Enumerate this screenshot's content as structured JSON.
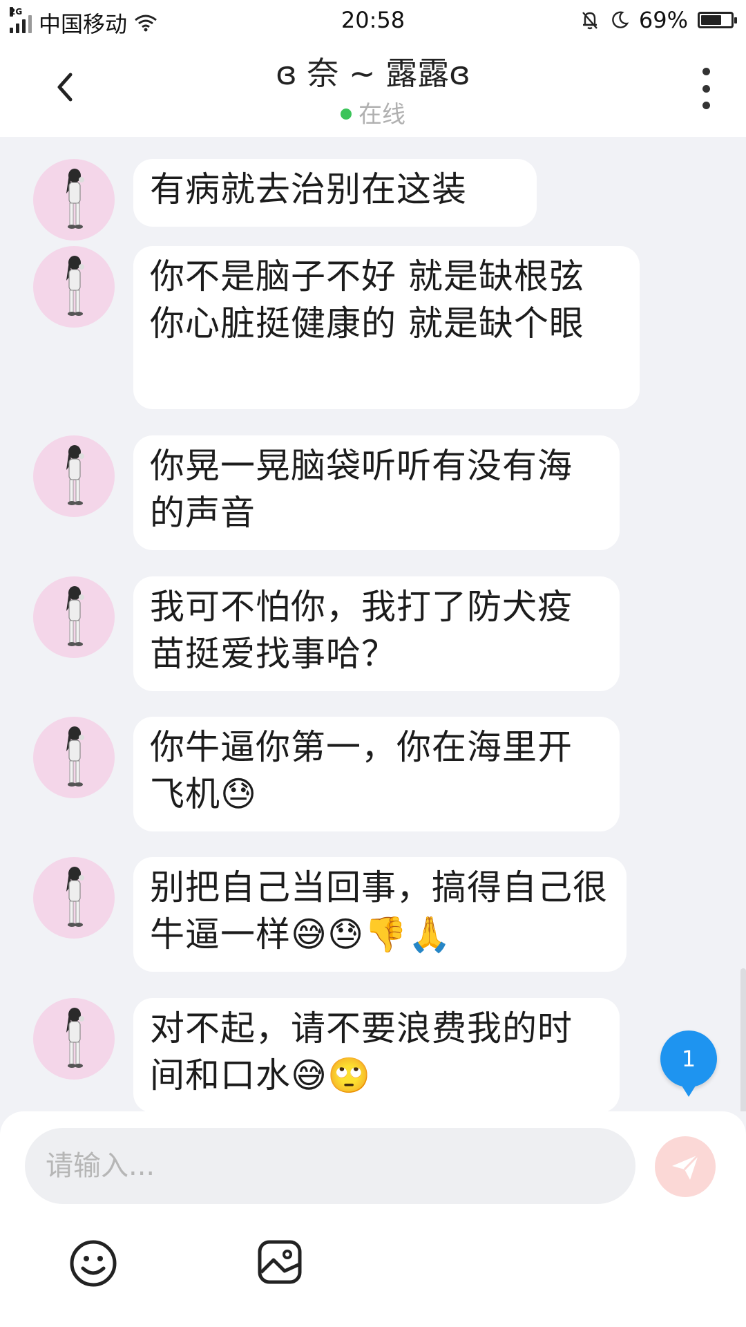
{
  "status_bar": {
    "network_type": "2G",
    "carrier": "中国移动",
    "time": "20:58",
    "battery_percent": "69%",
    "battery_level": 0.69
  },
  "header": {
    "title": "ɞ 奈 ~ 露露ɞ",
    "presence": "在线"
  },
  "messages": [
    {
      "text": "有病就去治别在这装"
    },
    {
      "text": "你不是脑子不好 就是缺根弦 你心脏挺健康的 就是缺个眼"
    },
    {
      "text": "你晃一晃脑袋听听有没有海的声音"
    },
    {
      "text": "我可不怕你，我打了防犬疫苗挺爱找事哈？"
    },
    {
      "text": "你牛逼你第一，你在海里开飞机😓"
    },
    {
      "text": "别把自己当回事，搞得自己很牛逼一样😅😓👎🙏"
    },
    {
      "text": "对不起，请不要浪费我的时间和口水😅🙄"
    }
  ],
  "unread_badge": "1",
  "composer": {
    "placeholder": "请输入..."
  },
  "colors": {
    "accent": "#1e94f0",
    "online": "#3cc45a",
    "send_disabled": "#fbd8d6",
    "background": "#f1f2f6"
  },
  "icons": [
    "back-icon",
    "more-icon",
    "send-icon",
    "emoji-icon",
    "image-icon",
    "wifi-icon",
    "mute-bell-icon",
    "moon-icon",
    "battery-icon"
  ]
}
